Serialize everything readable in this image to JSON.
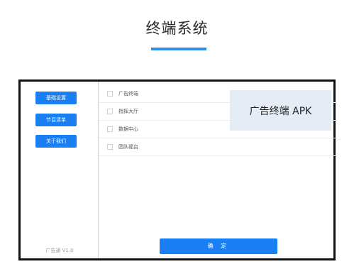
{
  "header": {
    "title": "终端系统"
  },
  "sidebar": {
    "buttons": [
      {
        "label": "基础设置"
      },
      {
        "label": "节目清单"
      },
      {
        "label": "关于我们"
      }
    ],
    "version": "广告通 V1.0"
  },
  "main": {
    "items": [
      {
        "label": "广告终端"
      },
      {
        "label": "指挥大厅"
      },
      {
        "label": "数据中心"
      },
      {
        "label": "团队福台"
      }
    ],
    "apk_label": "广告终端 APK",
    "confirm_label": "确 定"
  },
  "colors": {
    "accent": "#1a7ff2",
    "underline": "#2f8fe6",
    "panel": "#e6ecf5"
  }
}
